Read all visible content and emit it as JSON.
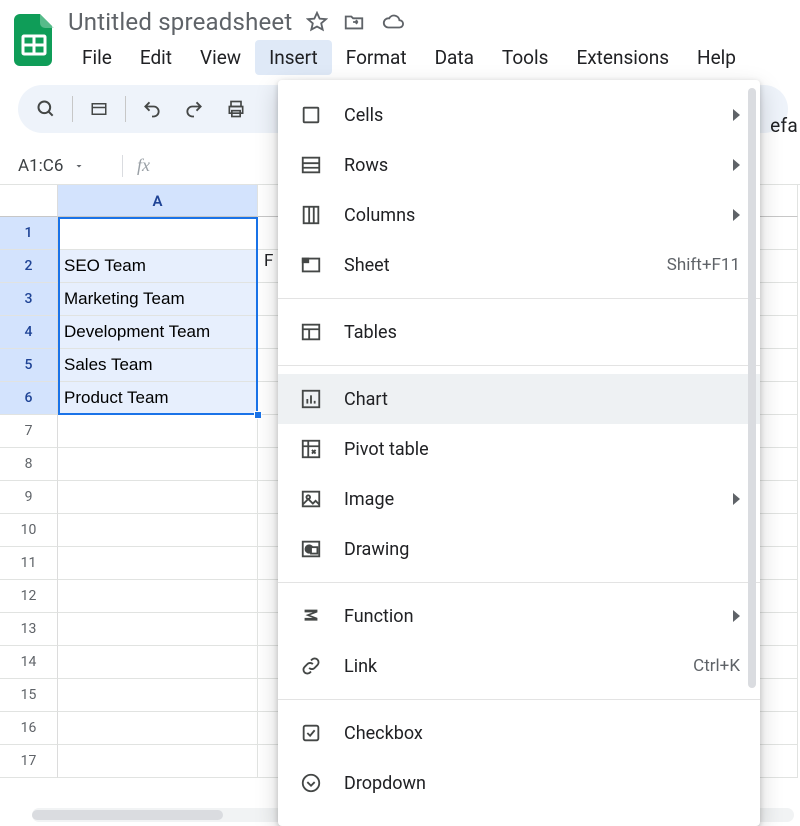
{
  "title": "Untitled spreadsheet",
  "menubar": [
    "File",
    "Edit",
    "View",
    "Insert",
    "Format",
    "Data",
    "Tools",
    "Extensions",
    "Help"
  ],
  "active_menu_index": 3,
  "namebox": "A1:C6",
  "columns": [
    "A"
  ],
  "rows_shown": 17,
  "selection": {
    "rows": [
      1,
      2,
      3,
      4,
      5,
      6
    ]
  },
  "cells_colA": [
    "",
    "SEO Team",
    "Marketing Team",
    "Development Team",
    "Sales Team",
    "Product Team"
  ],
  "peek_colB_row1": "F",
  "right_peek": "efa",
  "dropdown": {
    "items": [
      {
        "icon": "cells",
        "label": "Cells",
        "trail": "arrow"
      },
      {
        "icon": "rows",
        "label": "Rows",
        "trail": "arrow"
      },
      {
        "icon": "columns",
        "label": "Columns",
        "trail": "arrow"
      },
      {
        "icon": "sheet",
        "label": "Sheet",
        "trail": "Shift+F11"
      },
      {
        "sep": true
      },
      {
        "icon": "tables",
        "label": "Tables"
      },
      {
        "sep": true
      },
      {
        "icon": "chart",
        "label": "Chart",
        "hover": true
      },
      {
        "icon": "pivot",
        "label": "Pivot table"
      },
      {
        "icon": "image",
        "label": "Image",
        "trail": "arrow"
      },
      {
        "icon": "drawing",
        "label": "Drawing"
      },
      {
        "sep": true
      },
      {
        "icon": "function",
        "label": "Function",
        "trail": "arrow"
      },
      {
        "icon": "link",
        "label": "Link",
        "trail": "Ctrl+K"
      },
      {
        "sep": true
      },
      {
        "icon": "checkbox",
        "label": "Checkbox"
      },
      {
        "icon": "dropdown",
        "label": "Dropdown"
      }
    ]
  }
}
